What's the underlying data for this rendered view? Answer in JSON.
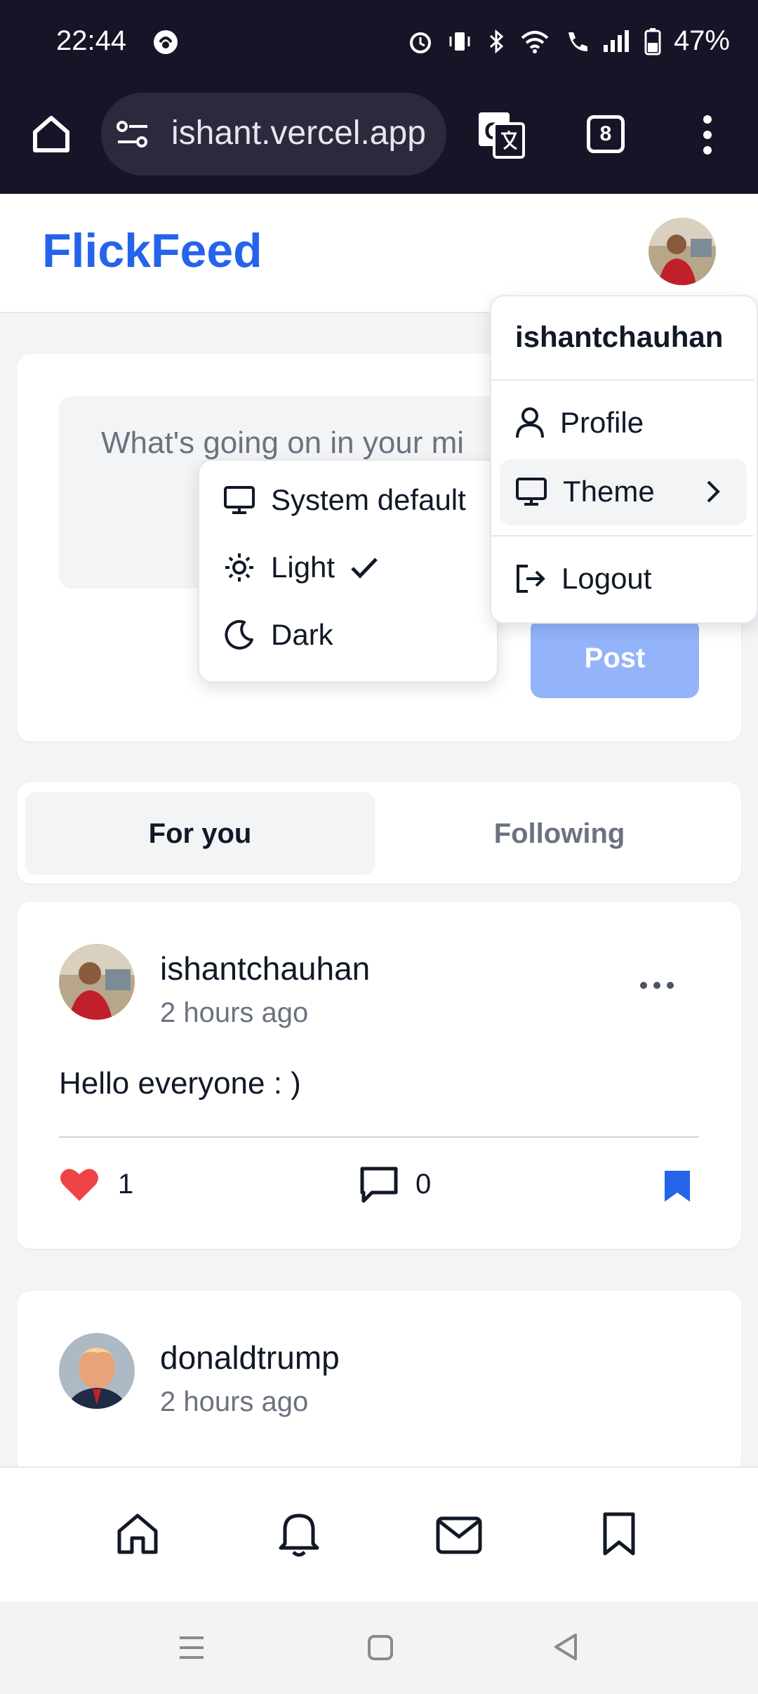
{
  "status_bar": {
    "time": "22:44",
    "battery": "47%"
  },
  "browser": {
    "url": "ishant.vercel.app",
    "tab_count": "8"
  },
  "app": {
    "brand": "FlickFeed"
  },
  "composer": {
    "placeholder": "What's going on in your mi",
    "post_label": "Post"
  },
  "tabs": [
    {
      "label": "For you",
      "active": true
    },
    {
      "label": "Following",
      "active": false
    }
  ],
  "posts": [
    {
      "author": "ishantchauhan",
      "time": "2 hours ago",
      "content": "Hello everyone : )",
      "likes": "1",
      "comments": "0",
      "liked": true,
      "bookmarked": true
    },
    {
      "author": "donaldtrump",
      "time": "2 hours ago"
    }
  ],
  "user_menu": {
    "username": "ishantchauhan",
    "items": [
      {
        "label": "Profile",
        "icon": "user-icon"
      },
      {
        "label": "Theme",
        "icon": "monitor-icon"
      },
      {
        "label": "Logout",
        "icon": "logout-icon"
      }
    ]
  },
  "theme_menu": {
    "options": [
      {
        "label": "System default",
        "icon": "monitor-icon"
      },
      {
        "label": "Light",
        "icon": "sun-icon",
        "selected": true
      },
      {
        "label": "Dark",
        "icon": "moon-icon"
      }
    ]
  },
  "colors": {
    "brand": "#2563eb",
    "like": "#ef4444",
    "bookmark": "#2563eb",
    "post_button_disabled": "#93b4fb"
  }
}
